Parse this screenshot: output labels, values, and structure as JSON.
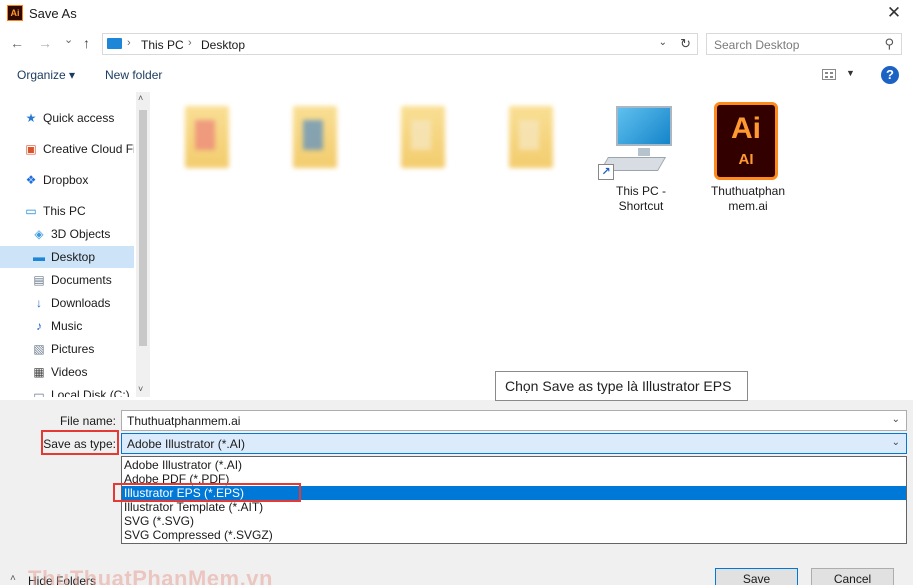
{
  "window": {
    "title": "Save As",
    "app_icon_text": "Ai",
    "close_glyph": "✕"
  },
  "nav": {
    "back": "←",
    "forward": "→",
    "recent": "⌄",
    "up": "↑",
    "breadcrumb": [
      "This PC",
      "Desktop"
    ],
    "breadcrumb_sep": "›",
    "dropdown": "⌄",
    "refresh": "↻",
    "search_placeholder": "Search Desktop",
    "search_glyph": "⚲"
  },
  "toolbar": {
    "organize": "Organize ▾",
    "new_folder": "New folder",
    "help": "?",
    "view_drop": "▼"
  },
  "sidebar": {
    "items": [
      {
        "label": "Quick access",
        "icon": "★",
        "color": "#2b79d1"
      },
      {
        "label": "Creative Cloud Fil",
        "icon": "▣",
        "color": "#d9532c"
      },
      {
        "label": "Dropbox",
        "icon": "❖",
        "color": "#1f6fe0"
      },
      {
        "label": "This PC",
        "icon": "▭",
        "color": "#1e86d6"
      },
      {
        "label": "3D Objects",
        "icon": "◈",
        "color": "#3c9be0"
      },
      {
        "label": "Desktop",
        "icon": "▬",
        "color": "#1e86d6"
      },
      {
        "label": "Documents",
        "icon": "▤",
        "color": "#6a7a8a"
      },
      {
        "label": "Downloads",
        "icon": "↓",
        "color": "#2169c7"
      },
      {
        "label": "Music",
        "icon": "♪",
        "color": "#2169c7"
      },
      {
        "label": "Pictures",
        "icon": "▧",
        "color": "#6a7a8a"
      },
      {
        "label": "Videos",
        "icon": "▦",
        "color": "#4a4a4a"
      },
      {
        "label": "Local Disk (C:)",
        "icon": "▭",
        "color": "#6a7a8a"
      }
    ],
    "scroll_up": "˄",
    "scroll_down": "˅"
  },
  "files": {
    "shortcut": {
      "label_line1": "This PC -",
      "label_line2": "Shortcut",
      "arrow": "↗"
    },
    "ai_file": {
      "icon_big": "Ai",
      "icon_small": "AI",
      "label_line1": "Thuthuatphan",
      "label_line2": "mem.ai"
    }
  },
  "tooltip": "Chọn Save as type là Illustrator EPS",
  "form": {
    "file_name_label": "File name:",
    "file_name_value": "Thuthuatphanmem.ai",
    "save_type_label": "Save as type:",
    "save_type_value": "Adobe Illustrator (*.AI)",
    "drop_glyph": "⌄"
  },
  "options": [
    "Adobe Illustrator (*.AI)",
    "Adobe PDF (*.PDF)",
    "Illustrator EPS (*.EPS)",
    "Illustrator Template (*.AIT)",
    "SVG (*.SVG)",
    "SVG Compressed (*.SVGZ)"
  ],
  "footer": {
    "hide_folders": "Hide Folders",
    "hide_chev": "˄",
    "watermark": "ThuThuatPhanMem.vn",
    "save": "Save",
    "cancel": "Cancel"
  },
  "colors": {
    "accent": "#0078d7",
    "highlight_box": "#e53935",
    "selected_nav": "#cde3f7"
  }
}
